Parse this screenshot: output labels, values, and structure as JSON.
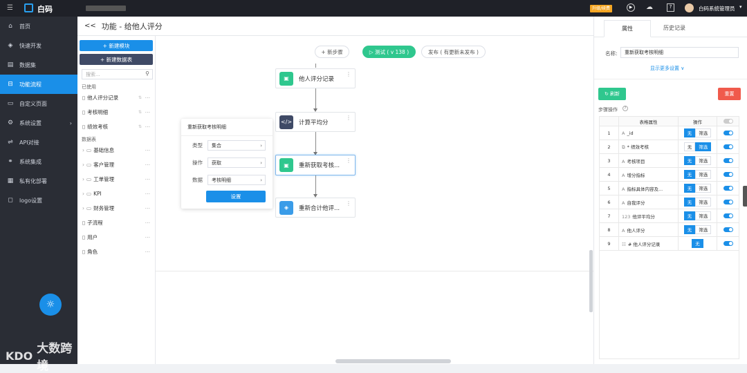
{
  "app": {
    "logo_text": "白码",
    "blurred_title": ""
  },
  "topbar": {
    "badge": "升级/续费",
    "user_name": "白码系统管理员"
  },
  "sidebar": {
    "items": [
      {
        "label": "首页",
        "icon": "home-icon"
      },
      {
        "label": "快速开发",
        "icon": "cube-icon"
      },
      {
        "label": "数据集",
        "icon": "database-icon"
      },
      {
        "label": "功能流程",
        "icon": "flow-icon",
        "active": true
      },
      {
        "label": "自定义页面",
        "icon": "page-icon"
      },
      {
        "label": "系统设置",
        "icon": "settings-icon"
      },
      {
        "label": "API对接",
        "icon": "api-icon"
      },
      {
        "label": "系统集成",
        "icon": "integration-icon"
      },
      {
        "label": "私有化部署",
        "icon": "server-icon"
      },
      {
        "label": "logo设置",
        "icon": "logo-icon"
      }
    ]
  },
  "header": {
    "back": "<<",
    "title": "功能 - 给他人评分"
  },
  "left_panel": {
    "new_module": "+ 新建模块",
    "new_table": "+ 新建数据表",
    "search_placeholder": "搜索...",
    "used_label": "已使用",
    "used_items": [
      "他人评分记录",
      "考核明细",
      "绩效考核"
    ],
    "tables_label": "数据表",
    "folders": [
      "基础信息",
      "客户管理",
      "工单管理",
      "KPI",
      "财务管理"
    ],
    "others": [
      "子流程",
      "用户",
      "角色"
    ]
  },
  "canvas": {
    "add_step": "+ 新步骤",
    "test_btn": "▷ 测试 ( v 138 )",
    "publish_btn": "发布 ( 有更新未发布 )",
    "nodes": [
      "他人评分记录",
      "计算平均分",
      "重新获取考核...",
      "重新合计他评..."
    ]
  },
  "popup": {
    "title": "重新获取考核明细",
    "rows": [
      {
        "label": "类型",
        "value": "集合"
      },
      {
        "label": "操作",
        "value": "获取"
      },
      {
        "label": "数据",
        "value": "考核明细"
      }
    ],
    "button": "设置"
  },
  "right_panel": {
    "tabs": [
      "属性",
      "历史记录"
    ],
    "name_label": "名称:",
    "name_value": "重新获取考核明细",
    "more_settings": "显示更多设置 ∨",
    "refresh_btn": "↻ 刷新",
    "reset_btn": "重置",
    "step_ops_label": "步骤操作",
    "table_headers": [
      "表格属性",
      "操作"
    ],
    "rows": [
      {
        "no": "1",
        "type": "A",
        "name": "_id",
        "a": "无",
        "b": "筛选",
        "on": "a"
      },
      {
        "no": "2",
        "type": "⧉",
        "name": "* 绩效考核",
        "a": "无",
        "b": "筛选",
        "on": "b"
      },
      {
        "no": "3",
        "type": "A",
        "name": "考核项目",
        "a": "无",
        "b": "筛选",
        "on": "a"
      },
      {
        "no": "4",
        "type": "A",
        "name": "增分指标",
        "a": "无",
        "b": "筛选",
        "on": "a"
      },
      {
        "no": "5",
        "type": "A",
        "name": "指标具体内容及...",
        "a": "无",
        "b": "筛选",
        "on": "a"
      },
      {
        "no": "6",
        "type": "A",
        "name": "自我评分",
        "a": "无",
        "b": "筛选",
        "on": "a"
      },
      {
        "no": "7",
        "type": "123",
        "name": "他评平均分",
        "a": "无",
        "b": "筛选",
        "on": "a"
      },
      {
        "no": "8",
        "type": "A",
        "name": "他人评分",
        "a": "无",
        "b": "筛选",
        "on": "a"
      },
      {
        "no": "9",
        "type": "☷",
        "name": "# 他人评分记录",
        "a": "无",
        "b": "",
        "on": "a"
      }
    ]
  },
  "watermark": "大数跨境",
  "colors": {
    "accent": "#1a8fe8",
    "green": "#2fc78e",
    "reset": "#f05a4c",
    "dark": "#3f4a66"
  }
}
